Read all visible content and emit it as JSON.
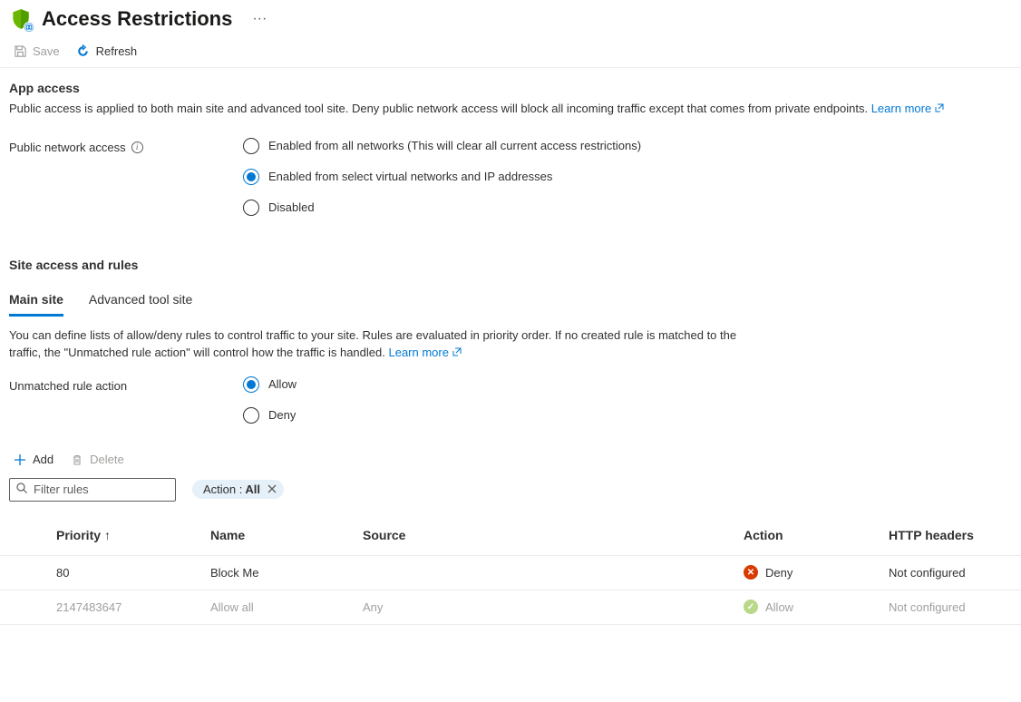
{
  "header": {
    "title": "Access Restrictions",
    "more_label": "···"
  },
  "toolbar": {
    "save_label": "Save",
    "refresh_label": "Refresh"
  },
  "app_access": {
    "title": "App access",
    "desc": "Public access is applied to both main site and advanced tool site. Deny public network access will block all incoming traffic except that comes from private endpoints.",
    "learn_more": "Learn more",
    "field_label": "Public network access",
    "options": [
      "Enabled from all networks (This will clear all current access restrictions)",
      "Enabled from select virtual networks and IP addresses",
      "Disabled"
    ],
    "selected_index": 1
  },
  "site_access": {
    "title": "Site access and rules",
    "tabs": [
      "Main site",
      "Advanced tool site"
    ],
    "active_tab": 0,
    "desc": "You can define lists of allow/deny rules to control traffic to your site. Rules are evaluated in priority order. If no created rule is matched to the traffic, the \"Unmatched rule action\" will control how the traffic is handled.",
    "learn_more": "Learn more",
    "unmatched_label": "Unmatched rule action",
    "unmatched_options": [
      "Allow",
      "Deny"
    ],
    "unmatched_selected": 0
  },
  "rules_cmd": {
    "add_label": "Add",
    "delete_label": "Delete"
  },
  "filter": {
    "search_placeholder": "Filter rules",
    "pill_label": "Action :",
    "pill_value": "All"
  },
  "table": {
    "headers": {
      "priority": "Priority",
      "name": "Name",
      "source": "Source",
      "action": "Action",
      "http": "HTTP headers"
    },
    "rows": [
      {
        "priority": "80",
        "name": "Block Me",
        "source": "",
        "action": "Deny",
        "action_type": "deny",
        "http": "Not configured",
        "muted": false
      },
      {
        "priority": "2147483647",
        "name": "Allow all",
        "source": "Any",
        "action": "Allow",
        "action_type": "allow",
        "http": "Not configured",
        "muted": true
      }
    ]
  }
}
